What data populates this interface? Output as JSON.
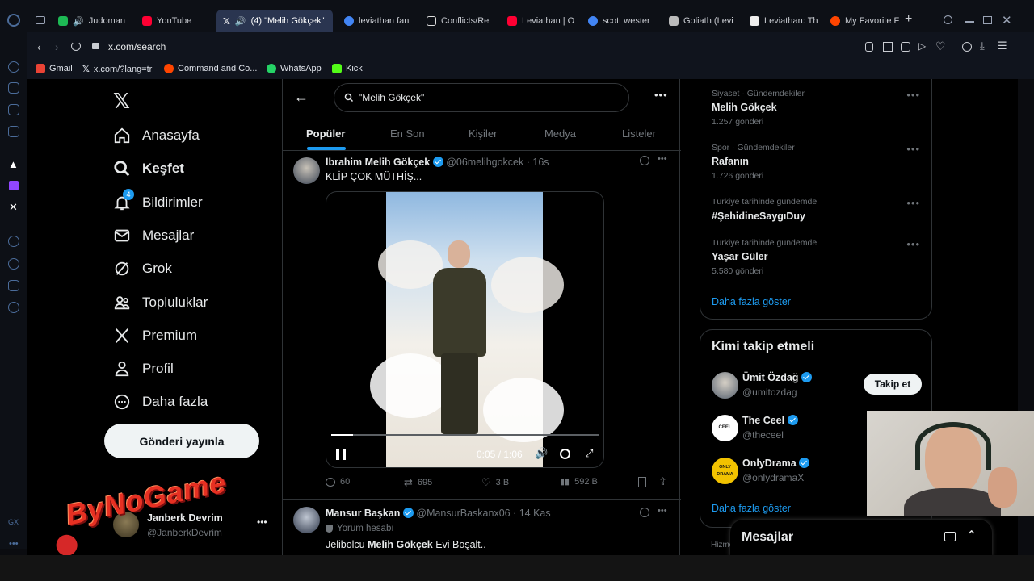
{
  "browser": {
    "tabs": [
      {
        "label": "Judoman",
        "color": "#1db954"
      },
      {
        "label": "YouTube",
        "color": "#ff0033"
      },
      {
        "label": "(4) \"Melih Gökçek\"",
        "color": "#ffffff",
        "active": true
      },
      {
        "label": "leviathan fan",
        "color": "#4285f4"
      },
      {
        "label": "Conflicts/Re",
        "color": "#dddddd"
      },
      {
        "label": "Leviathan | O",
        "color": "#ff0033"
      },
      {
        "label": "scott wester",
        "color": "#4285f4"
      },
      {
        "label": "Goliath (Levi",
        "color": "#bbbbbb"
      },
      {
        "label": "Leviathan: Th",
        "color": "#eeeeee"
      },
      {
        "label": "My Favorite F",
        "color": "#ff4500"
      }
    ],
    "url": "x.com/search",
    "bookmarks": [
      "Gmail",
      "x.com/?lang=tr",
      "Command and Co...",
      "WhatsApp",
      "Kick"
    ]
  },
  "sidebar": {
    "items": [
      {
        "label": "Anasayfa",
        "icon": "home-icon"
      },
      {
        "label": "Keşfet",
        "icon": "search-icon",
        "bold": true
      },
      {
        "label": "Bildirimler",
        "icon": "bell-icon",
        "badge": "4"
      },
      {
        "label": "Mesajlar",
        "icon": "mail-icon"
      },
      {
        "label": "Grok",
        "icon": "grok-icon"
      },
      {
        "label": "Topluluklar",
        "icon": "communities-icon"
      },
      {
        "label": "Premium",
        "icon": "x-logo-icon"
      },
      {
        "label": "Profil",
        "icon": "person-icon"
      },
      {
        "label": "Daha fazla",
        "icon": "more-circle-icon"
      }
    ],
    "post_button": "Gönderi yayınla",
    "account": {
      "name": "Janberk Devrim",
      "handle": "@JanberkDevrim"
    },
    "overlay_logo": "ByNoGame"
  },
  "search": {
    "query": "\"Melih Gökçek\"",
    "tabs": [
      "Popüler",
      "En Son",
      "Kişiler",
      "Medya",
      "Listeler"
    ]
  },
  "tweets": [
    {
      "name": "İbrahim Melih Gökçek",
      "handle": "@06melihgokcek",
      "time": "· 16s",
      "text": "KLİP ÇOK MÜTHİŞ...",
      "video_time": "0:05 / 1:06",
      "progress": 0.08,
      "replies": "60",
      "retweets": "695",
      "likes": "3 B",
      "views": "592 B"
    },
    {
      "name": "Mansur Başkan",
      "handle": "@MansurBaskanx06",
      "time": "· 14 Kas",
      "note": "Yorum hesabı",
      "text_pre": "Jelibolcu ",
      "text_bold": "Melih Gökçek",
      "text_post": " Evi Boşalt.."
    }
  ],
  "trends": [
    {
      "meta": "Siyaset · Gündemdekiler",
      "title": "Melih Gökçek",
      "count": "1.257 gönderi"
    },
    {
      "meta": "Spor · Gündemdekiler",
      "title": "Rafanın",
      "count": "1.726 gönderi"
    },
    {
      "meta": "Türkiye tarihinde gündemde",
      "title": "#ŞehidineSaygıDuy",
      "count": ""
    },
    {
      "meta": "Türkiye tarihinde gündemde",
      "title": "Yaşar Güler",
      "count": "5.580 gönderi"
    }
  ],
  "trends_more": "Daha fazla göster",
  "who_to_follow": {
    "title": "Kimi takip etmeli",
    "users": [
      {
        "name": "Ümit Özdağ",
        "handle": "@umitozdag",
        "button": "Takip et"
      },
      {
        "name": "The Ceel",
        "handle": "@theceel",
        "avatar_text": "CEEL"
      },
      {
        "name": "OnlyDrama",
        "handle": "@onlydramaX",
        "avatar_text": "ONLY DRAMA"
      }
    ],
    "more": "Daha fazla göster"
  },
  "messages_drawer": "Mesajlar",
  "footer_partial": "Hizme",
  "colors": {
    "accent": "#1d9bf0",
    "background": "#000000",
    "border": "#2f3336"
  }
}
